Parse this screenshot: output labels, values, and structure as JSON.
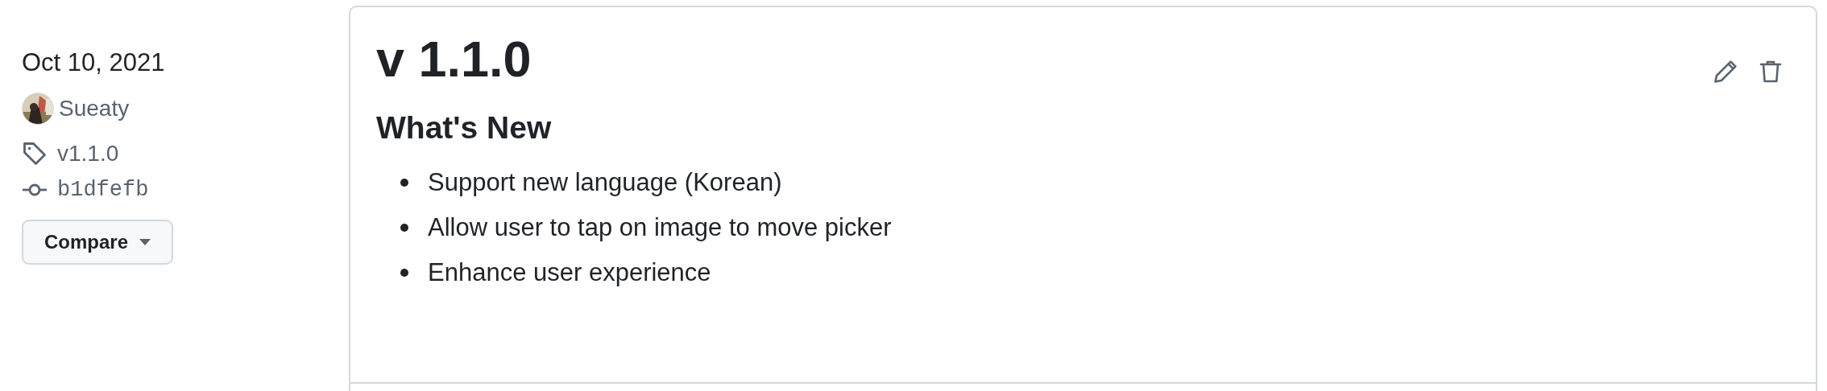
{
  "sidebar": {
    "date": "Oct 10, 2021",
    "author": {
      "name": "Sueaty"
    },
    "tag": "v1.1.0",
    "commit": "b1dfefb",
    "compare_button": "Compare"
  },
  "release": {
    "title": "v 1.1.0",
    "heading": "What's New",
    "items": [
      "Support new language (Korean)",
      "Allow user to tap on image to move picker",
      "Enhance user experience"
    ]
  }
}
